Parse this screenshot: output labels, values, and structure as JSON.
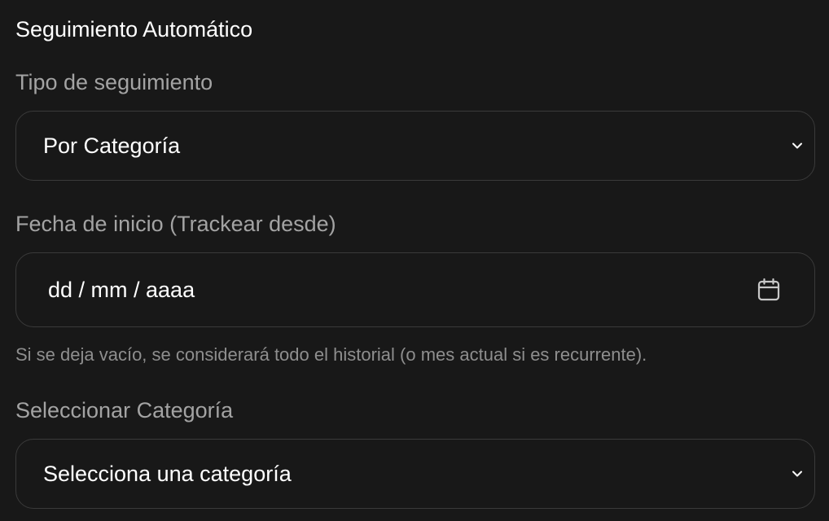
{
  "section": {
    "title": "Seguimiento Automático"
  },
  "tracking_type": {
    "label": "Tipo de seguimiento",
    "selected_value": "Por Categoría",
    "icon": "chevron-down-icon"
  },
  "start_date": {
    "label": "Fecha de inicio (Trackear desde)",
    "placeholder": "dd / mm / aaaa",
    "icon": "calendar-icon",
    "helper": "Si se deja vacío, se considerará todo el historial (o mes actual si es recurrente)."
  },
  "category": {
    "label": "Seleccionar Categoría",
    "selected_value": "Selecciona una categoría",
    "icon": "chevron-down-icon"
  },
  "colors": {
    "background": "#181818",
    "border": "#3a3a3a",
    "text": "#ffffff",
    "label": "#a3a3a3",
    "helper": "#8e8e8e"
  }
}
